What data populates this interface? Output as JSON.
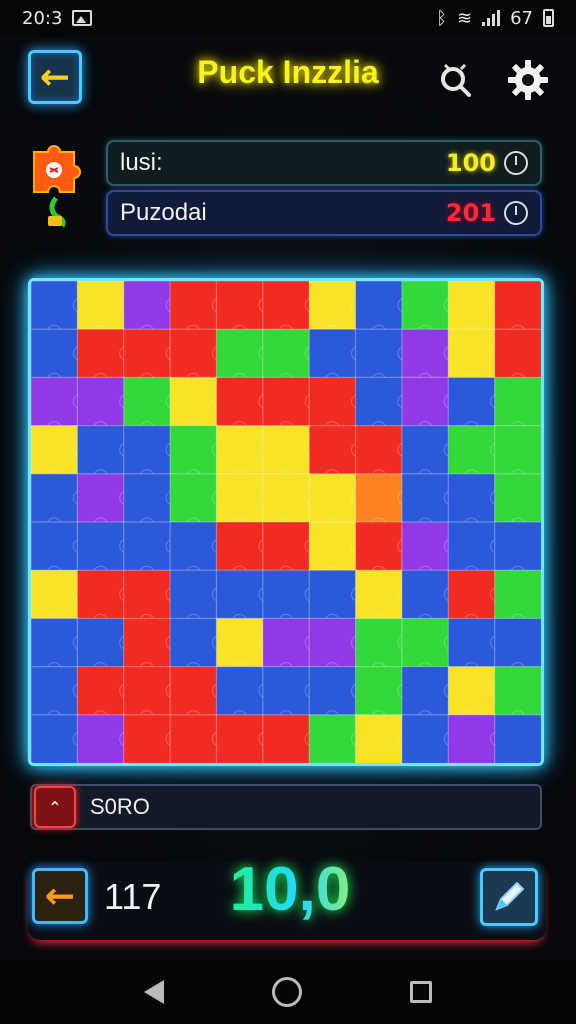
{
  "status_bar": {
    "time": "20:3",
    "battery": "67"
  },
  "header": {
    "title": "Puck Inzzlia",
    "back_icon": "arrow-left-icon",
    "hint_icon": "magnifier-icon",
    "settings_icon": "gear-icon"
  },
  "stats": [
    {
      "label": "lusi:",
      "value": "100",
      "color": "#f4ec28"
    },
    {
      "label": "Puzodai",
      "value": "201",
      "color": "#ff2b3a"
    }
  ],
  "board": {
    "rows": 10,
    "cols": 11,
    "palette": {
      "blue": "#1e4fd8",
      "red": "#f01e14",
      "yellow": "#f7e21a",
      "green": "#27d62f",
      "purple": "#8a2ee6",
      "orange": "#ff7a12"
    },
    "cells": [
      "B Y P R R R Y B G Y R",
      "B R R R G G B B P Y R",
      "P P G Y R R R B P B G",
      "Y B B G Y Y R R B G G",
      "B P B G Y Y Y O B B G",
      "B B B B R R Y R P B B",
      "Y R R B B B B Y B R G",
      "B B R B Y P P G G B B",
      "B R R R B B B G B Y G",
      "B P R R R R G Y B P B"
    ]
  },
  "score_bar": {
    "label": "S0RO"
  },
  "bottom": {
    "moves": "117",
    "score": "10,0"
  }
}
